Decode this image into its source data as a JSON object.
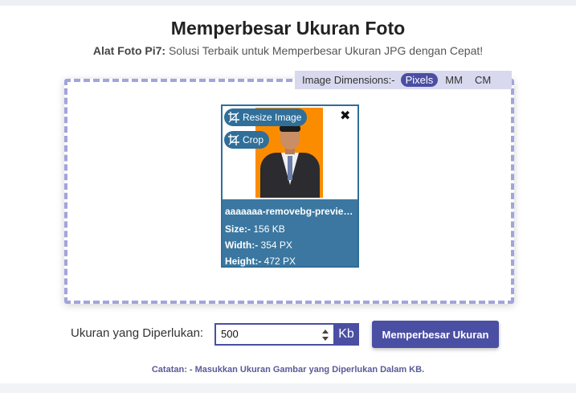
{
  "header": {
    "title": "Memperbesar Ukuran Foto",
    "subtitle_brand": "Alat Foto Pi7:",
    "subtitle_text": " Solusi Terbaik untuk Memperbesar Ukuran JPG dengan Cepat!"
  },
  "dimensions": {
    "label": "Image Dimensions:-",
    "options": [
      "Pixels",
      "MM",
      "CM"
    ],
    "selected": "Pixels"
  },
  "image_card": {
    "resize_label": "Resize Image",
    "crop_label": "Crop",
    "close_symbol": "✖",
    "filename": "aaaaaaa-removebg-preview.jpg",
    "size_label": "Size:-",
    "size_value": " 156 KB",
    "width_label": "Width:-",
    "width_value": " 354 PX",
    "height_label": "Height:-",
    "height_value": " 472 PX"
  },
  "form": {
    "required_label": "Ukuran yang Diperlukan:",
    "size_value": "500",
    "unit": "Kb",
    "submit_label": "Memperbesar Ukuran"
  },
  "note": "Catatan: - Masukkan Ukuran Gambar yang Diperlukan Dalam KB.",
  "colors": {
    "accent": "#4a4fa3",
    "card_blue": "#3b77a0",
    "dash_border": "#a3a3dc"
  },
  "icons": [
    "crop-icon",
    "close-icon",
    "spinner-icon"
  ]
}
